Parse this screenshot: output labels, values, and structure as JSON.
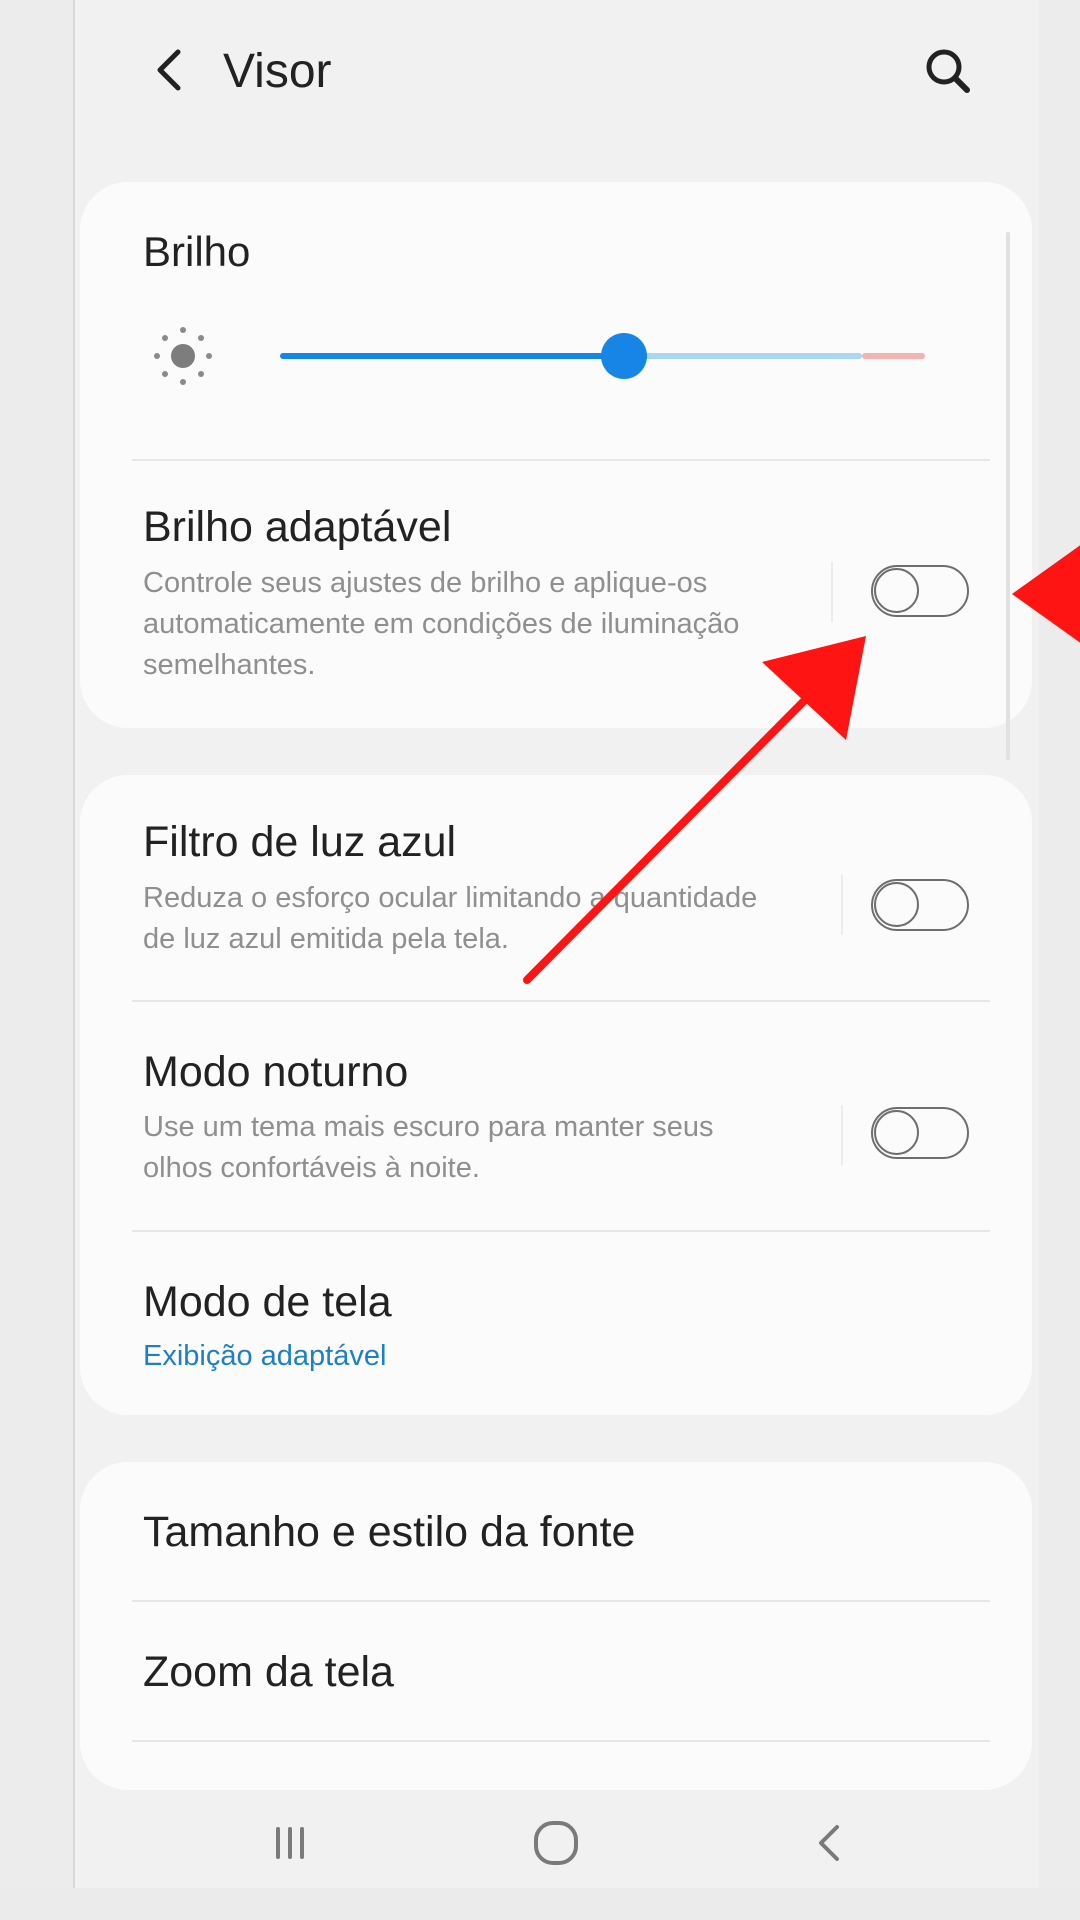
{
  "header": {
    "title": "Visor",
    "back_icon": "chevron-left-icon",
    "search_icon": "search-icon"
  },
  "brightness": {
    "label": "Brilho",
    "icon": "brightness-sun-icon",
    "level": 0.53,
    "colors": {
      "active": "#1685e6",
      "inactive": "#a8d7f5",
      "warning": "#f3b3b3"
    }
  },
  "settings": [
    {
      "label": "Brilho adaptável",
      "description": "Controle seus ajustes de brilho e aplique-os automaticamente em condições de iluminação semelhantes.",
      "toggle_on": false
    },
    {
      "label": "Filtro de luz azul",
      "description": "Reduza o esforço ocular limitando a quantidade de luz azul emitida pela tela.",
      "toggle_on": false
    },
    {
      "label": "Modo noturno",
      "description": "Use um tema mais escuro para manter seus olhos confortáveis à noite.",
      "toggle_on": false
    },
    {
      "label": "Modo de tela",
      "value": "Exibição adaptável"
    },
    {
      "label": "Tamanho e estilo da fonte"
    },
    {
      "label": "Zoom da tela"
    }
  ],
  "nav": {
    "recent_icon": "recent-apps-icon",
    "home_icon": "home-icon",
    "back_icon": "back-icon"
  },
  "annotations": {
    "arrow_color": "#ff1414"
  }
}
